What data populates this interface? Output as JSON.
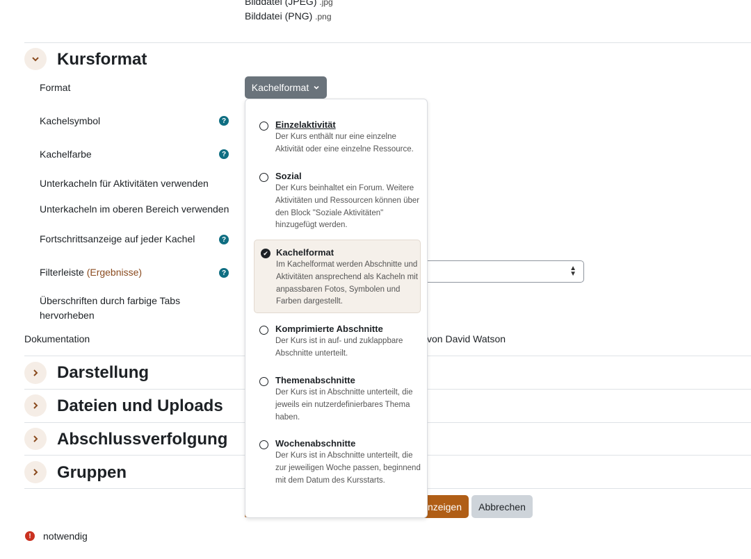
{
  "filetypes": [
    {
      "name": "Bilddatei (JPEG)",
      "ext": ".jpg"
    },
    {
      "name": "Bilddatei (PNG)",
      "ext": ".png"
    }
  ],
  "sections": {
    "kursformat": "Kursformat",
    "darstellung": "Darstellung",
    "dateien": "Dateien und Uploads",
    "abschluss": "Abschlussverfolgung",
    "gruppen": "Gruppen"
  },
  "form": {
    "format_label": "Format",
    "format_value": "Kachelformat",
    "kachelsymbol": "Kachelsymbol",
    "kachelfarbe": "Kachelfarbe",
    "unterkacheln_aktivitaeten": "Unterkacheln für Aktivitäten verwenden",
    "unterkacheln_oben": "Unterkacheln im oberen Bereich verwenden",
    "fortschritt": "Fortschrittsanzeige auf jeder Kachel",
    "filterleiste": "Filterleiste",
    "filterleiste_link": "(Ergebnisse)",
    "ueberschriften_1": "Überschriften durch farbige Tabs",
    "ueberschriften_2": "hervorheben",
    "dokumentation": "Dokumentation",
    "dokumentation_value": "von David Watson"
  },
  "buttons": {
    "save_partial": "nzeigen",
    "cancel": "Abbrechen"
  },
  "required_text": "notwendig",
  "dropdown": {
    "options": [
      {
        "title": "Einzelaktivität",
        "desc": "Der Kurs enthält nur eine einzelne Aktivität oder eine einzelne Ressource."
      },
      {
        "title": "Sozial",
        "desc": "Der Kurs beinhaltet ein Forum. Weitere Aktivitäten und Ressourcen können über den Block \"Soziale Aktivitäten\" hinzugefügt werden."
      },
      {
        "title": "Kachelformat",
        "desc": "Im Kachelformat werden Abschnitte und Aktivitäten ansprechend als Kacheln mit anpassbaren Fotos, Symbolen und Farben dargestellt."
      },
      {
        "title": "Komprimierte Abschnitte",
        "desc": "Der Kurs ist in auf- und zuklappbare Abschnitte unterteilt."
      },
      {
        "title": "Themenabschnitte",
        "desc": "Der Kurs ist in Abschnitte unterteilt, die jeweils ein nutzerdefinierbares Thema haben."
      },
      {
        "title": "Wochenabschnitte",
        "desc": "Der Kurs ist in Abschnitte unterteilt, die zur jeweiligen Woche passen, beginnend mit dem Datum des Kursstarts."
      }
    ]
  },
  "colors": {
    "accent": "#b05e16",
    "help": "#0f6e82",
    "required": "#ca3120"
  }
}
